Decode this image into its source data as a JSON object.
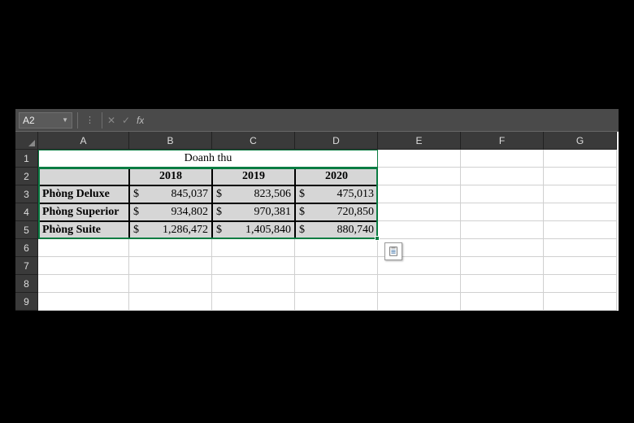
{
  "name_box": {
    "value": "A2"
  },
  "formula_bar": {
    "fx_label": "fx",
    "value": ""
  },
  "col_headers": [
    "A",
    "B",
    "C",
    "D",
    "E",
    "F",
    "G"
  ],
  "row_headers": [
    "1",
    "2",
    "3",
    "4",
    "5",
    "6",
    "7",
    "8",
    "9"
  ],
  "table": {
    "title": "Doanh thu",
    "years": [
      "2018",
      "2019",
      "2020"
    ],
    "currency": "$",
    "rows": [
      {
        "label": "Phòng Deluxe",
        "values": [
          "845,037",
          "823,506",
          "475,013"
        ]
      },
      {
        "label": "Phòng Superior",
        "values": [
          "934,802",
          "970,381",
          "720,850"
        ]
      },
      {
        "label": "Phòng Suite",
        "values": [
          "1,286,472",
          "1,405,840",
          "880,740"
        ]
      }
    ]
  },
  "selection": {
    "ref": "A2:D5"
  },
  "icons": {
    "cancel": "✕",
    "enter": "✓"
  }
}
